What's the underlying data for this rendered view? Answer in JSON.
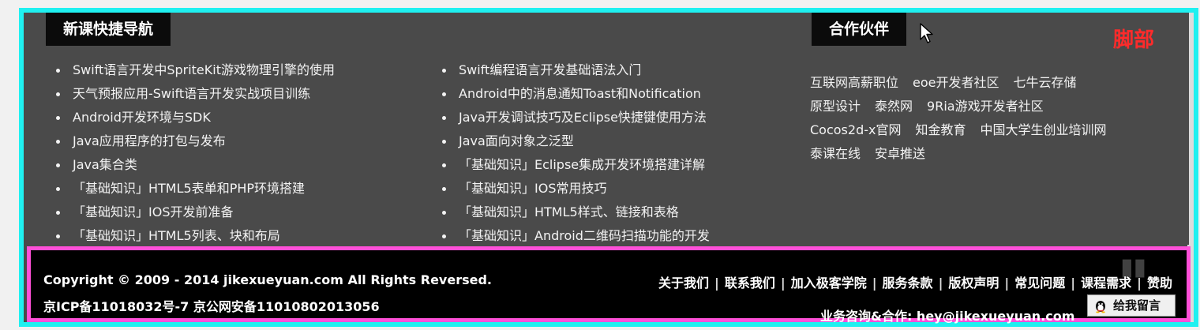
{
  "annotation": {
    "footer_tag": "脚部"
  },
  "new_courses": {
    "title": "新课快捷导航",
    "column1": [
      "Swift语言开发中SpriteKit游戏物理引擎的使用",
      "天气预报应用-Swift语言开发实战项目训练",
      "Android开发环境与SDK",
      "Java应用程序的打包与发布",
      "Java集合类",
      "「基础知识」HTML5表单和PHP环境搭建",
      "「基础知识」IOS开发前准备",
      "「基础知识」HTML5列表、块和布局"
    ],
    "column2": [
      "Swift编程语言开发基础语法入门",
      "Android中的消息通知Toast和Notification",
      "Java开发调试技巧及Eclipse快捷键使用方法",
      "Java面向对象之泛型",
      "「基础知识」Eclipse集成开发环境搭建详解",
      "「基础知识」IOS常用技巧",
      "「基础知识」HTML5样式、链接和表格",
      "「基础知识」Android二维码扫描功能的开发"
    ]
  },
  "partners": {
    "title": "合作伙伴",
    "rows": [
      [
        "互联网高薪职位",
        "eoe开发者社区",
        "七牛云存储"
      ],
      [
        "原型设计",
        "泰然网",
        "9Ria游戏开发者社区"
      ],
      [
        "Cocos2d-x官网",
        "知金教育",
        "中国大学生创业培训网"
      ],
      [
        "泰课在线",
        "安卓推送"
      ]
    ]
  },
  "bottom": {
    "copyright": "Copyright © 2009 - 2014 jikexueyuan.com All Rights Reversed.",
    "icp": "京ICP备11018032号-7 京公网安备11010802013056",
    "nav": [
      "关于我们",
      "联系我们",
      "加入极客学院",
      "服务条款",
      "版权声明",
      "常见问题",
      "课程需求",
      "赞助"
    ],
    "contact": "业务咨询&合作: hey@jikexueyuan.com",
    "message_button": "给我留言"
  },
  "colors": {
    "cyan_frame": "#1ff0f0",
    "magenta_frame": "#ff4fd8",
    "footer_tag": "#ff2b2b",
    "background": "#4a4a4a"
  }
}
